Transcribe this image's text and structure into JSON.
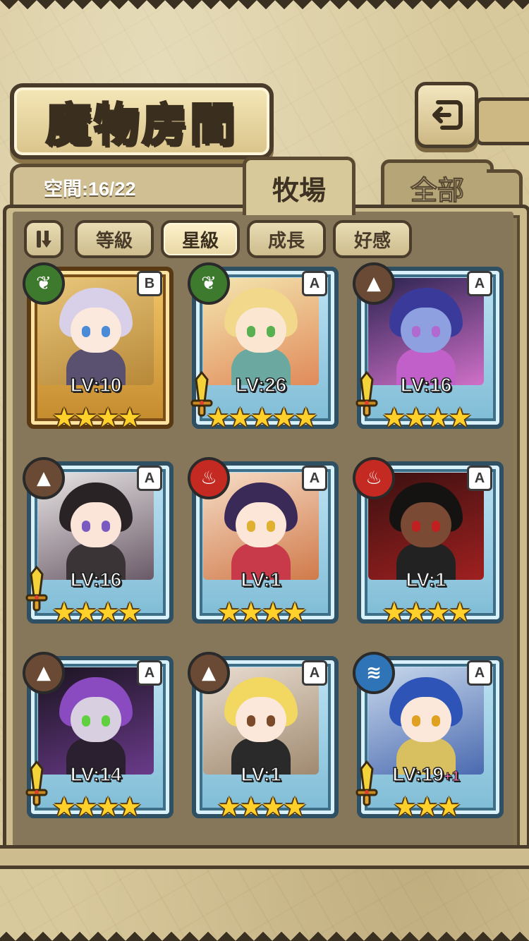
{
  "header": {
    "title": "魔物房間",
    "back_icon": "back-arrow-icon"
  },
  "capacity": {
    "text": "空間:16/22"
  },
  "tabs": [
    {
      "label": "牧場",
      "active": true
    },
    {
      "label": "全部",
      "active": false
    }
  ],
  "filters": {
    "toggle_icon": "pause-toggle-icon",
    "items": [
      {
        "label": "等級",
        "active": false
      },
      {
        "label": "星級",
        "active": true
      },
      {
        "label": "成長",
        "active": false
      },
      {
        "label": "好感",
        "active": false
      }
    ]
  },
  "monsters": [
    {
      "rank": "B",
      "element": "grass",
      "level": "LV:10",
      "plus": "",
      "stars": "★★★★",
      "star_count": 4,
      "weapon": false,
      "frame": "gold",
      "colors": {
        "c1": "#e9c77c",
        "c2": "#b78838",
        "hair": "#d8cfe8",
        "skin": "#fbe9dd",
        "eye": "#4a8ad6",
        "cloth": "#5a5070"
      }
    },
    {
      "rank": "A",
      "element": "grass",
      "level": "LV:26",
      "plus": "",
      "stars": "★★★★★",
      "star_count": 5,
      "weapon": true,
      "frame": "blue",
      "colors": {
        "c1": "#f4e6b0",
        "c2": "#e08a5a",
        "hair": "#f1d88a",
        "skin": "#fbe6d2",
        "eye": "#58b050",
        "cloth": "#6aa8a0"
      }
    },
    {
      "rank": "A",
      "element": "earth",
      "level": "LV:16",
      "plus": "",
      "stars": "★★★★",
      "star_count": 4,
      "weapon": true,
      "frame": "blue",
      "colors": {
        "c1": "#2a2350",
        "c2": "#d070c8",
        "hair": "#3a3a9a",
        "skin": "#8fa0e0",
        "eye": "#b06ad0",
        "cloth": "#c060c8"
      }
    },
    {
      "rank": "A",
      "element": "earth",
      "level": "LV:16",
      "plus": "",
      "stars": "★★★★",
      "star_count": 4,
      "weapon": true,
      "frame": "blue",
      "colors": {
        "c1": "#e8e4e4",
        "c2": "#6a5a68",
        "hair": "#2a2326",
        "skin": "#fbe4d8",
        "eye": "#7a5ac0",
        "cloth": "#3a3436"
      }
    },
    {
      "rank": "A",
      "element": "fire",
      "level": "LV:1",
      "plus": "",
      "stars": "★★★★",
      "star_count": 4,
      "weapon": false,
      "frame": "blue",
      "colors": {
        "c1": "#f6dcc6",
        "c2": "#d07a4a",
        "hair": "#3a2a58",
        "skin": "#fbe6d8",
        "eye": "#e0b030",
        "cloth": "#c83a4a"
      }
    },
    {
      "rank": "A",
      "element": "fire",
      "level": "LV:1",
      "plus": "",
      "stars": "★★★★",
      "star_count": 4,
      "weapon": false,
      "frame": "blue",
      "colors": {
        "c1": "#3a1010",
        "c2": "#a02020",
        "hair": "#151212",
        "skin": "#7a4a34",
        "eye": "#c02020",
        "cloth": "#222"
      }
    },
    {
      "rank": "A",
      "element": "earth",
      "level": "LV:14",
      "plus": "",
      "stars": "★★★★",
      "star_count": 4,
      "weapon": true,
      "frame": "blue",
      "colors": {
        "c1": "#1a1420",
        "c2": "#6a3a8a",
        "hair": "#8a4ac0",
        "skin": "#d8d0e0",
        "eye": "#60d040",
        "cloth": "#2a2030"
      }
    },
    {
      "rank": "A",
      "element": "earth",
      "level": "LV:1",
      "plus": "",
      "stars": "★★★★",
      "star_count": 4,
      "weapon": false,
      "frame": "blue",
      "colors": {
        "c1": "#e8dcd0",
        "c2": "#a08a70",
        "hair": "#f2d860",
        "skin": "#fbe8da",
        "eye": "#7a4a2a",
        "cloth": "#2a2a2a"
      }
    },
    {
      "rank": "A",
      "element": "water",
      "level": "LV:19",
      "plus": "+1",
      "stars": "★★★",
      "star_count": 3,
      "weapon": true,
      "frame": "blue",
      "colors": {
        "c1": "#c8d8ec",
        "c2": "#4a6ab0",
        "hair": "#2e54b8",
        "skin": "#fbe8da",
        "eye": "#e0a020",
        "cloth": "#d8c060"
      }
    }
  ]
}
